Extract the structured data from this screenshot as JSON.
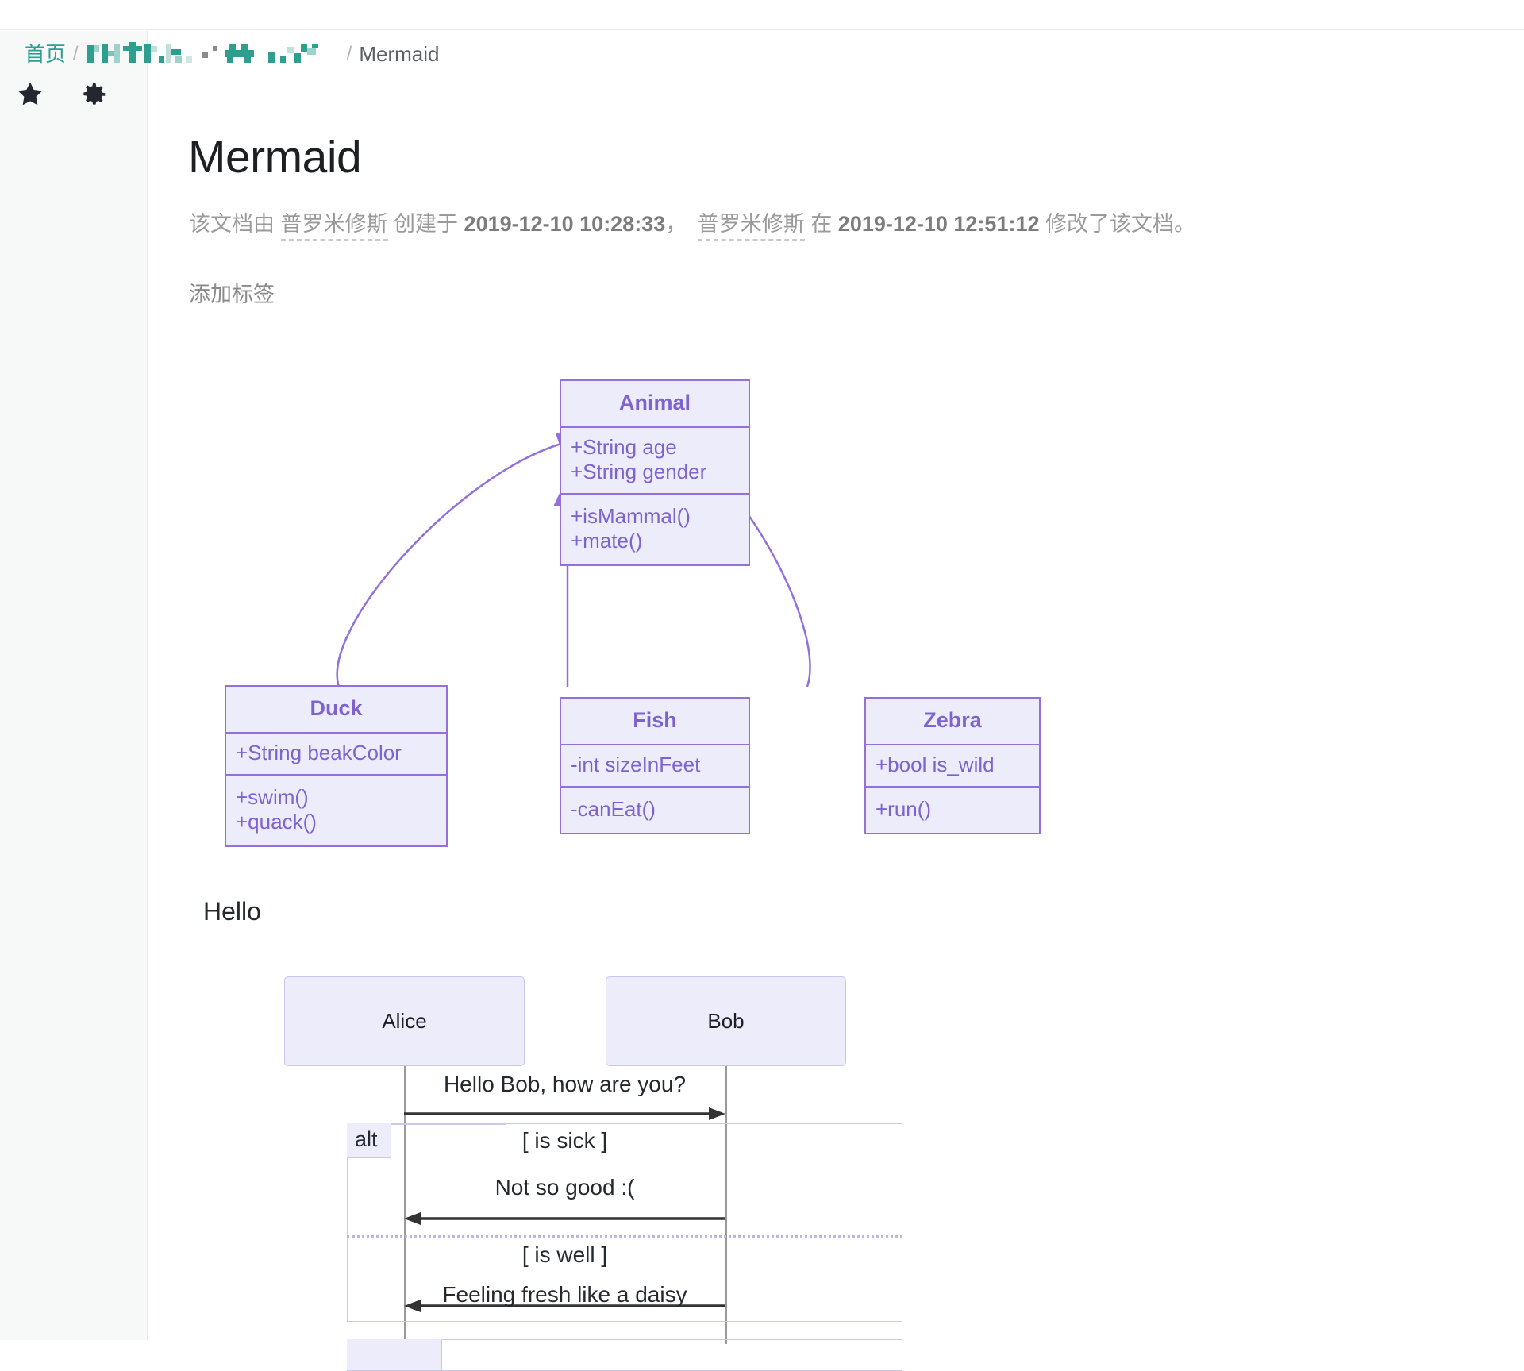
{
  "sidebar": {
    "icons": [
      {
        "name": "star-icon",
        "label": "收藏"
      },
      {
        "name": "gear-icon",
        "label": "设置"
      }
    ]
  },
  "breadcrumb": {
    "home": "首页",
    "separator": "/",
    "redacted_label": "",
    "current": "Mermaid"
  },
  "page": {
    "title": "Mermaid",
    "meta": {
      "prefix": "该文档由",
      "author": "普罗米修斯",
      "created_label": "创建于",
      "created_at": "2019-12-10 10:28:33",
      "comma": "，",
      "editor": "普罗米修斯",
      "at_label": "在",
      "modified_at": "2019-12-10 12:51:12",
      "suffix": "修改了该文档。"
    },
    "add_tag": "添加标签"
  },
  "class_diagram": {
    "accent_border": "#9370db",
    "accent_fill": "#ececfb",
    "accent_text": "#7e63cf",
    "classes": [
      {
        "id": "animal",
        "name": "Animal",
        "attributes": [
          "+String age",
          "+String gender"
        ],
        "methods": [
          "+isMammal()",
          "+mate()"
        ]
      },
      {
        "id": "duck",
        "name": "Duck",
        "attributes": [
          "+String beakColor"
        ],
        "methods": [
          "+swim()",
          "+quack()"
        ]
      },
      {
        "id": "fish",
        "name": "Fish",
        "attributes": [
          "-int sizeInFeet"
        ],
        "methods": [
          "-canEat()"
        ]
      },
      {
        "id": "zebra",
        "name": "Zebra",
        "attributes": [
          "+bool is_wild"
        ],
        "methods": [
          "+run()"
        ]
      }
    ],
    "relations": [
      {
        "from": "duck",
        "to": "animal",
        "type": "inheritance"
      },
      {
        "from": "fish",
        "to": "animal",
        "type": "inheritance"
      },
      {
        "from": "zebra",
        "to": "animal",
        "type": "inheritance"
      }
    ]
  },
  "hello_text": "Hello",
  "sequence_diagram": {
    "actors": [
      {
        "id": "alice",
        "name": "Alice"
      },
      {
        "id": "bob",
        "name": "Bob"
      }
    ],
    "messages": [
      {
        "from": "alice",
        "to": "bob",
        "text": "Hello Bob, how are you?",
        "direction": "right"
      }
    ],
    "alt": {
      "keyword": "alt",
      "branches": [
        {
          "condition": "[ is sick ]",
          "messages": [
            {
              "from": "bob",
              "to": "alice",
              "text": "Not so good :(",
              "direction": "left"
            }
          ]
        },
        {
          "condition": "[ is well ]",
          "messages": [
            {
              "from": "bob",
              "to": "alice",
              "text": "Feeling fresh like a daisy",
              "direction": "left"
            }
          ]
        }
      ]
    }
  }
}
